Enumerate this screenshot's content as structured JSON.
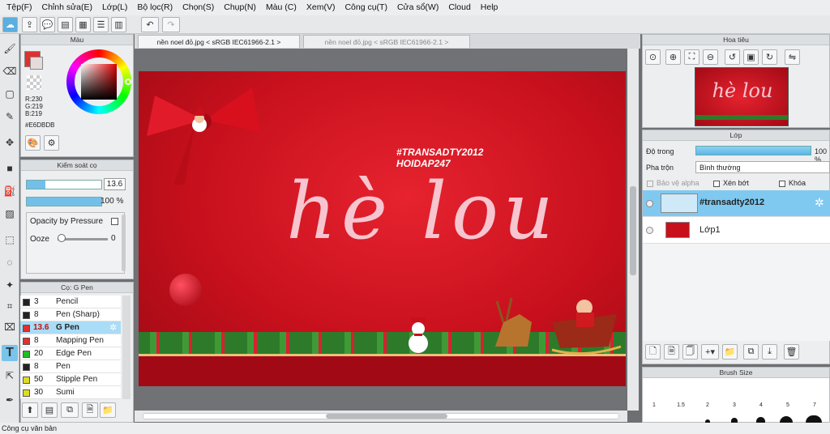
{
  "menubar": [
    "Tệp(F)",
    "Chỉnh sửa(E)",
    "Lớp(L)",
    "Bộ lọc(R)",
    "Chọn(S)",
    "Chụp(N)",
    "Màu (C)",
    "Xem(V)",
    "Công cụ(T)",
    "Cửa sổ(W)",
    "Cloud",
    "Help"
  ],
  "color_panel": {
    "title": "Màu",
    "r": "R:230",
    "g": "G:219",
    "b": "B:219",
    "hex": "#E6DBDB",
    "main_color": "#e6dbdb"
  },
  "brush_control": {
    "title": "Kiểm soát cọ",
    "size": "13.6",
    "opacity": "100 %",
    "opacity_pressure": "Opacity by Pressure",
    "ooze": "Ooze",
    "ooze_value": "0"
  },
  "brush_list": {
    "title": "Cọ: G Pen",
    "items": [
      {
        "size": "3",
        "name": "Pencil",
        "color": "#222222"
      },
      {
        "size": "8",
        "name": "Pen (Sharp)",
        "color": "#222222"
      },
      {
        "size": "13.6",
        "name": "G Pen",
        "color": "#e03030"
      },
      {
        "size": "8",
        "name": "Mapping Pen",
        "color": "#e03030"
      },
      {
        "size": "20",
        "name": "Edge Pen",
        "color": "#22bb22"
      },
      {
        "size": "8",
        "name": "Pen",
        "color": "#222222"
      },
      {
        "size": "50",
        "name": "Stipple Pen",
        "color": "#dddd22"
      },
      {
        "size": "30",
        "name": "Sumi",
        "color": "#dddd22"
      }
    ]
  },
  "doc_tabs": [
    {
      "label": "nền noel đỏ.jpg < sRGB IEC61966-2.1 >"
    },
    {
      "label": "nền noel đỏ.jpg < sRGB IEC61966-2.1 >"
    }
  ],
  "canvas": {
    "hashtag1": "#TRANSADTY2012",
    "hashtag2": "HOIDAP247",
    "main_text": "hè lou"
  },
  "navigator": {
    "title": "Hoa tiêu",
    "thumb_text": "hè lou"
  },
  "layers": {
    "title": "Lớp",
    "opacity_label": "Độ trong",
    "opacity_value": "100 %",
    "blend_label": "Pha trộn",
    "blend_value": "Bình thường",
    "protect_alpha": "Bảo vệ alpha",
    "clipping": "Xén bớt",
    "lock": "Khóa",
    "items": [
      {
        "name": "#transadty2012"
      },
      {
        "name": "Lớp1"
      }
    ]
  },
  "brush_size": {
    "title": "Brush Size",
    "sizes": [
      "1",
      "1.5",
      "2",
      "3",
      "4",
      "5",
      "7"
    ]
  },
  "status": "Công cụ văn bản"
}
